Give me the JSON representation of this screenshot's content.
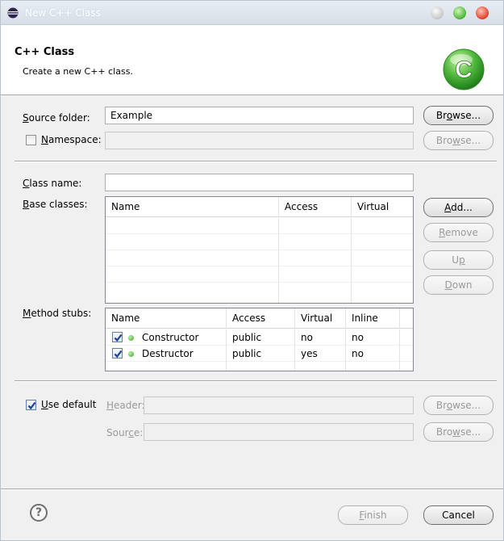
{
  "window": {
    "title": "New C++ Class",
    "accent_color": "#3aa52c"
  },
  "banner": {
    "title": "C++ Class",
    "description": "Create a new C++ class.",
    "logo_letter": "C"
  },
  "source_folder": {
    "label_pre": "",
    "label_key": "S",
    "label_post": "ource folder:",
    "value": "Example",
    "browse": {
      "pre": "Br",
      "key": "o",
      "post": "wse..."
    }
  },
  "namespace": {
    "label_pre": "",
    "label_key": "N",
    "label_post": "amespace:",
    "checked": false,
    "value": "",
    "browse": {
      "pre": "Bro",
      "key": "w",
      "post": "se..."
    }
  },
  "class_name": {
    "label_pre": "",
    "label_key": "C",
    "label_post": "lass name:",
    "value": ""
  },
  "base_classes": {
    "label_pre": "",
    "label_key": "B",
    "label_post": "ase classes:",
    "columns": [
      "Name",
      "Access",
      "Virtual"
    ],
    "rows": [],
    "buttons": {
      "add": {
        "pre": "",
        "key": "A",
        "post": "dd..."
      },
      "remove": {
        "pre": "",
        "key": "R",
        "post": "emove"
      },
      "up": {
        "pre": "U",
        "key": "p",
        "post": ""
      },
      "down": {
        "pre": "",
        "key": "D",
        "post": "own"
      }
    }
  },
  "method_stubs": {
    "label_pre": "",
    "label_key": "M",
    "label_post": "ethod stubs:",
    "columns": [
      "Name",
      "Access",
      "Virtual",
      "Inline"
    ],
    "rows": [
      {
        "checked": true,
        "name": "Constructor",
        "access": "public",
        "virtual": "no",
        "inline": "no"
      },
      {
        "checked": true,
        "name": "Destructor",
        "access": "public",
        "virtual": "yes",
        "inline": "no"
      }
    ]
  },
  "use_default": {
    "label_pre": "",
    "label_key": "U",
    "label_post": "se default",
    "checked": true,
    "header": {
      "pre": "",
      "key": "H",
      "post": "eader:",
      "value": "",
      "browse": {
        "pre": "Br",
        "key": "o",
        "post": "wse..."
      }
    },
    "source": {
      "pre": "Sour",
      "key": "c",
      "post": "e:",
      "value": "",
      "browse": {
        "pre": "Bro",
        "key": "w",
        "post": "se..."
      }
    }
  },
  "footer": {
    "help_glyph": "?",
    "finish": {
      "pre": "",
      "key": "F",
      "post": "inish"
    },
    "cancel": "Cancel"
  }
}
